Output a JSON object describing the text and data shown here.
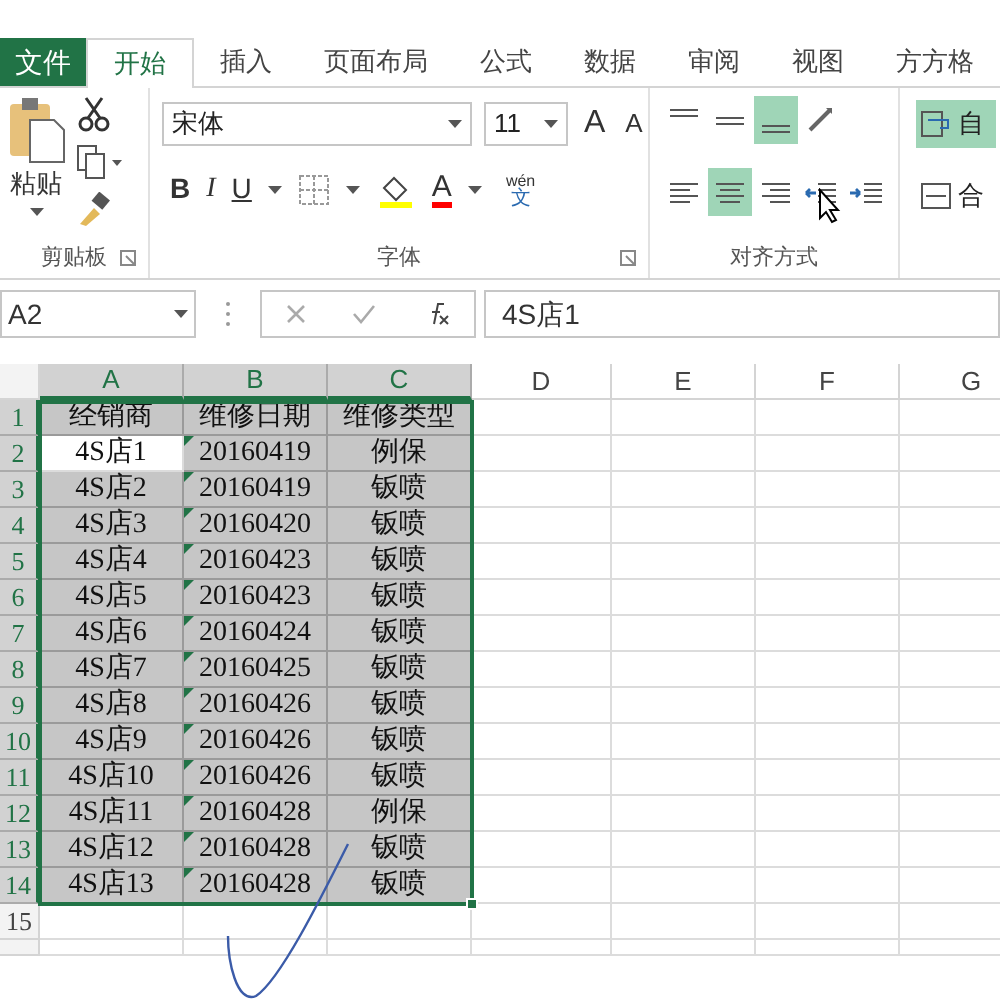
{
  "tabs": [
    {
      "label": "文件",
      "kind": "file",
      "selected": false
    },
    {
      "label": "开始",
      "kind": "tab",
      "selected": true
    },
    {
      "label": "插入",
      "kind": "tab",
      "selected": false
    },
    {
      "label": "页面布局",
      "kind": "tab",
      "selected": false
    },
    {
      "label": "公式",
      "kind": "tab",
      "selected": false
    },
    {
      "label": "数据",
      "kind": "tab",
      "selected": false
    },
    {
      "label": "审阅",
      "kind": "tab",
      "selected": false
    },
    {
      "label": "视图",
      "kind": "tab",
      "selected": false
    },
    {
      "label": "方方格",
      "kind": "tab",
      "selected": false
    }
  ],
  "clipboard": {
    "paste_label": "粘贴",
    "group_label": "剪贴板"
  },
  "font": {
    "font_name": "宋体",
    "font_size": "11",
    "grow": "A",
    "shrink": "A",
    "bold": "B",
    "italic": "I",
    "underline": "U",
    "font_color": "A",
    "phonetic_top": "wén",
    "phonetic_bottom": "文",
    "group_label": "字体"
  },
  "alignment": {
    "group_label": "对齐方式",
    "top_buttons": [
      {
        "kind": "top",
        "selected": false
      },
      {
        "kind": "middle",
        "selected": false
      },
      {
        "kind": "bottom",
        "selected": true
      },
      {
        "kind": "orient",
        "selected": false
      }
    ],
    "bottom_buttons": [
      {
        "kind": "left",
        "selected": false
      },
      {
        "kind": "center",
        "selected": true
      },
      {
        "kind": "right",
        "selected": false
      },
      {
        "kind": "outdent",
        "selected": false
      },
      {
        "kind": "indent",
        "selected": false
      }
    ]
  },
  "wrap": {
    "label": "自",
    "selected": true
  },
  "merge": {
    "label": "合"
  },
  "formula_bar": {
    "name_box": "A2",
    "formula": "4S店1"
  },
  "columns": [
    {
      "label": "A",
      "selected": true
    },
    {
      "label": "B",
      "selected": true
    },
    {
      "label": "C",
      "selected": true
    },
    {
      "label": "D",
      "selected": false
    },
    {
      "label": "E",
      "selected": false
    },
    {
      "label": "F",
      "selected": false
    },
    {
      "label": "G",
      "selected": false
    }
  ],
  "rows": [
    {
      "header": "1",
      "selected": true,
      "cells": [
        {
          "text": "经销商",
          "active": false,
          "flag": false
        },
        {
          "text": "维修日期",
          "active": false,
          "flag": false
        },
        {
          "text": "维修类型",
          "active": false,
          "flag": false
        }
      ]
    },
    {
      "header": "2",
      "selected": true,
      "cells": [
        {
          "text": "4S店1",
          "active": true,
          "flag": false
        },
        {
          "text": "20160419",
          "active": false,
          "flag": true
        },
        {
          "text": "例保",
          "active": false,
          "flag": false
        }
      ]
    },
    {
      "header": "3",
      "selected": true,
      "cells": [
        {
          "text": "4S店2",
          "active": false,
          "flag": false
        },
        {
          "text": "20160419",
          "active": false,
          "flag": true
        },
        {
          "text": "钣喷",
          "active": false,
          "flag": false
        }
      ]
    },
    {
      "header": "4",
      "selected": true,
      "cells": [
        {
          "text": "4S店3",
          "active": false,
          "flag": false
        },
        {
          "text": "20160420",
          "active": false,
          "flag": true
        },
        {
          "text": "钣喷",
          "active": false,
          "flag": false
        }
      ]
    },
    {
      "header": "5",
      "selected": true,
      "cells": [
        {
          "text": "4S店4",
          "active": false,
          "flag": false
        },
        {
          "text": "20160423",
          "active": false,
          "flag": true
        },
        {
          "text": "钣喷",
          "active": false,
          "flag": false
        }
      ]
    },
    {
      "header": "6",
      "selected": true,
      "cells": [
        {
          "text": "4S店5",
          "active": false,
          "flag": false
        },
        {
          "text": "20160423",
          "active": false,
          "flag": true
        },
        {
          "text": "钣喷",
          "active": false,
          "flag": false
        }
      ]
    },
    {
      "header": "7",
      "selected": true,
      "cells": [
        {
          "text": "4S店6",
          "active": false,
          "flag": false
        },
        {
          "text": "20160424",
          "active": false,
          "flag": true
        },
        {
          "text": "钣喷",
          "active": false,
          "flag": false
        }
      ]
    },
    {
      "header": "8",
      "selected": true,
      "cells": [
        {
          "text": "4S店7",
          "active": false,
          "flag": false
        },
        {
          "text": "20160425",
          "active": false,
          "flag": true
        },
        {
          "text": "钣喷",
          "active": false,
          "flag": false
        }
      ]
    },
    {
      "header": "9",
      "selected": true,
      "cells": [
        {
          "text": "4S店8",
          "active": false,
          "flag": false
        },
        {
          "text": "20160426",
          "active": false,
          "flag": true
        },
        {
          "text": "钣喷",
          "active": false,
          "flag": false
        }
      ]
    },
    {
      "header": "10",
      "selected": true,
      "cells": [
        {
          "text": "4S店9",
          "active": false,
          "flag": false
        },
        {
          "text": "20160426",
          "active": false,
          "flag": true
        },
        {
          "text": "钣喷",
          "active": false,
          "flag": false
        }
      ]
    },
    {
      "header": "11",
      "selected": true,
      "cells": [
        {
          "text": "4S店10",
          "active": false,
          "flag": false
        },
        {
          "text": "20160426",
          "active": false,
          "flag": true
        },
        {
          "text": "钣喷",
          "active": false,
          "flag": false
        }
      ]
    },
    {
      "header": "12",
      "selected": true,
      "cells": [
        {
          "text": "4S店11",
          "active": false,
          "flag": false
        },
        {
          "text": "20160428",
          "active": false,
          "flag": true
        },
        {
          "text": "例保",
          "active": false,
          "flag": false
        }
      ]
    },
    {
      "header": "13",
      "selected": true,
      "cells": [
        {
          "text": "4S店12",
          "active": false,
          "flag": false
        },
        {
          "text": "20160428",
          "active": false,
          "flag": true
        },
        {
          "text": "钣喷",
          "active": false,
          "flag": false
        }
      ]
    },
    {
      "header": "14",
      "selected": true,
      "cells": [
        {
          "text": "4S店13",
          "active": false,
          "flag": false
        },
        {
          "text": "20160428",
          "active": false,
          "flag": true
        },
        {
          "text": "钣喷",
          "active": false,
          "flag": false
        }
      ]
    },
    {
      "header": "15",
      "selected": false,
      "cells": []
    }
  ]
}
